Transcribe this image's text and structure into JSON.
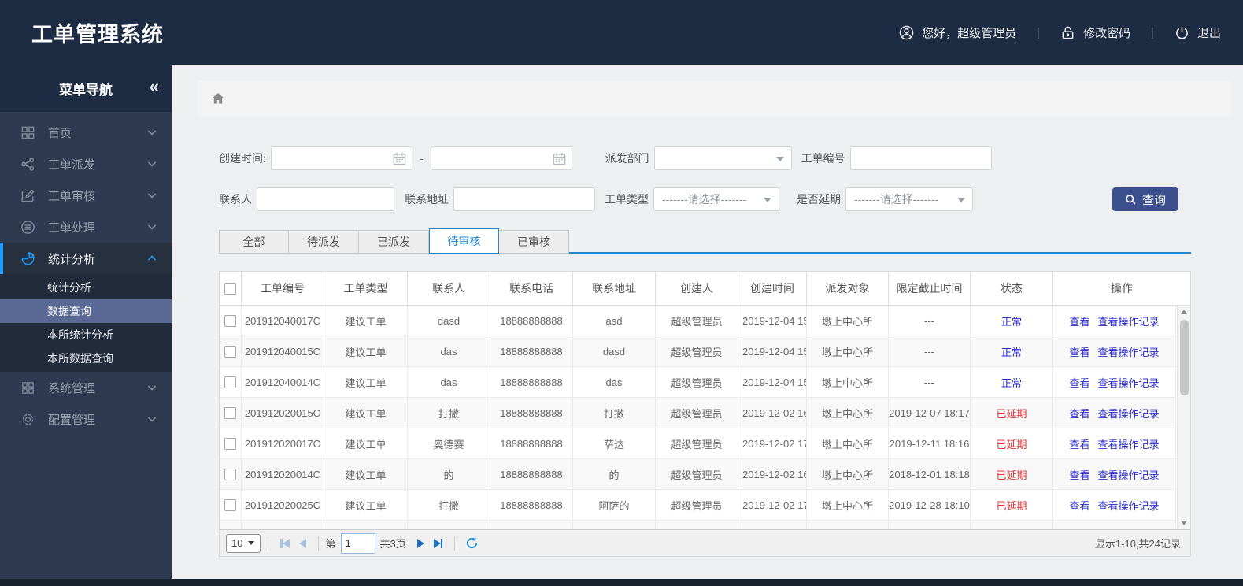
{
  "header": {
    "title": "工单管理系统",
    "greeting": "您好，超级管理员",
    "change_password": "修改密码",
    "logout": "退出"
  },
  "sidebar": {
    "title": "菜单导航",
    "collapse_glyph": "«",
    "items": [
      {
        "label": "首页"
      },
      {
        "label": "工单派发"
      },
      {
        "label": "工单审核"
      },
      {
        "label": "工单处理"
      },
      {
        "label": "统计分析"
      },
      {
        "label": "系统管理"
      },
      {
        "label": "配置管理"
      }
    ],
    "submenu": [
      {
        "label": "统计分析",
        "active": false
      },
      {
        "label": "数据查询",
        "active": true
      },
      {
        "label": "本所统计分析",
        "active": false
      },
      {
        "label": "本所数据查询",
        "active": false
      }
    ]
  },
  "filters": {
    "created_time_label": "创建时间:",
    "range_separator": "-",
    "dispatch_dept_label": "派发部门",
    "order_no_label": "工单编号",
    "contact_label": "联系人",
    "address_label": "联系地址",
    "order_type_label": "工单类型",
    "delay_label": "是否延期",
    "select_placeholder": "-------请选择-------",
    "search_button": "查询"
  },
  "tabs": [
    {
      "label": "全部",
      "active": false
    },
    {
      "label": "待派发",
      "active": false
    },
    {
      "label": "已派发",
      "active": false
    },
    {
      "label": "待审核",
      "active": true
    },
    {
      "label": "已审核",
      "active": false
    }
  ],
  "table": {
    "columns": [
      "工单编号",
      "工单类型",
      "联系人",
      "联系电话",
      "联系地址",
      "创建人",
      "创建时间",
      "派发对象",
      "限定截止时间",
      "状态",
      "操作"
    ],
    "action_labels": [
      "查看",
      "查看操作记录"
    ],
    "status_colors": {
      "正常": "#2929d0",
      "已延期": "#e03030"
    },
    "rows": [
      {
        "order_no": "201912040017C",
        "type": "建议工单",
        "contact": "dasd",
        "phone": "18888888888",
        "address": "asd",
        "creator": "超级管理员",
        "created": "2019-12-04 15",
        "target": "墩上中心所",
        "deadline": "---",
        "status": "正常"
      },
      {
        "order_no": "201912040015C",
        "type": "建议工单",
        "contact": "das",
        "phone": "18888888888",
        "address": "dasd",
        "creator": "超级管理员",
        "created": "2019-12-04 15",
        "target": "墩上中心所",
        "deadline": "---",
        "status": "正常"
      },
      {
        "order_no": "201912040014C",
        "type": "建议工单",
        "contact": "das",
        "phone": "18888888888",
        "address": "das",
        "creator": "超级管理员",
        "created": "2019-12-04 15",
        "target": "墩上中心所",
        "deadline": "---",
        "status": "正常"
      },
      {
        "order_no": "201912020015C",
        "type": "建议工单",
        "contact": "打撒",
        "phone": "18888888888",
        "address": "打撒",
        "creator": "超级管理员",
        "created": "2019-12-02 16",
        "target": "墩上中心所",
        "deadline": "2019-12-07 18:17",
        "status": "已延期"
      },
      {
        "order_no": "201912020017C",
        "type": "建议工单",
        "contact": "奥德赛",
        "phone": "18888888888",
        "address": "萨达",
        "creator": "超级管理员",
        "created": "2019-12-02 17",
        "target": "墩上中心所",
        "deadline": "2019-12-11 18:16",
        "status": "已延期"
      },
      {
        "order_no": "201912020014C",
        "type": "建议工单",
        "contact": "的",
        "phone": "18888888888",
        "address": "的",
        "creator": "超级管理员",
        "created": "2019-12-02 16",
        "target": "墩上中心所",
        "deadline": "2018-12-01 18:18",
        "status": "已延期"
      },
      {
        "order_no": "201912020025C",
        "type": "建议工单",
        "contact": "打撒",
        "phone": "18888888888",
        "address": "阿萨的",
        "creator": "超级管理员",
        "created": "2019-12-02 17",
        "target": "墩上中心所",
        "deadline": "2019-12-28 18:10",
        "status": "已延期"
      }
    ]
  },
  "pagination": {
    "page_size": "10",
    "page_prefix": "第",
    "current_page": "1",
    "total_pages": "共3页",
    "summary": "显示1-10,共24记录"
  }
}
